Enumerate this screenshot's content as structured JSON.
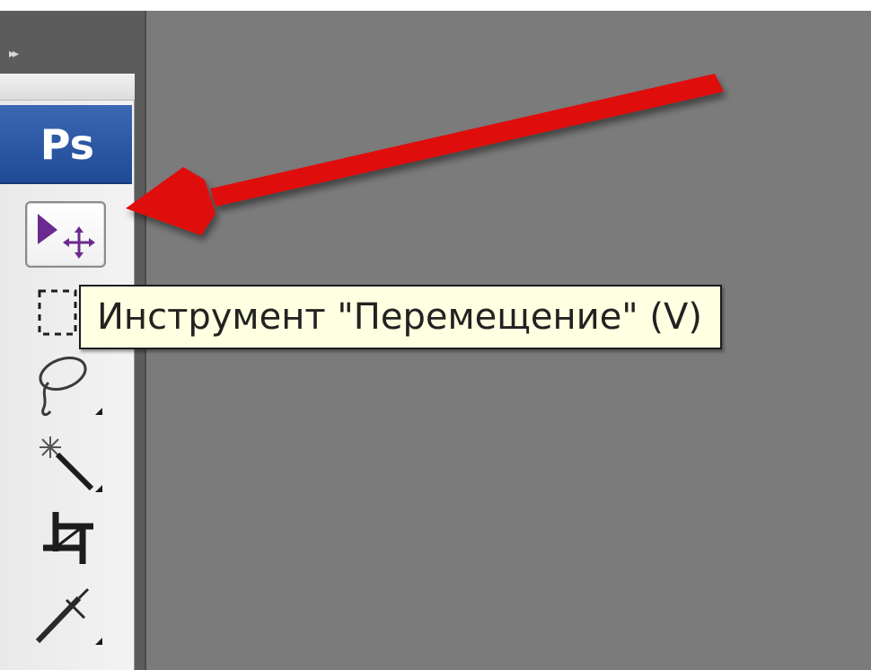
{
  "panel": {
    "collapse_icon": "double-chevron-right-icon",
    "collapse_glyph": "▸▸"
  },
  "toolbar": {
    "logo_text": "Ps",
    "tools": [
      {
        "name": "move-tool",
        "icon": "move-icon",
        "selected": true
      },
      {
        "name": "marquee-tool",
        "icon": "marquee-icon",
        "selected": false
      },
      {
        "name": "lasso-tool",
        "icon": "lasso-icon",
        "selected": false
      },
      {
        "name": "magic-wand-tool",
        "icon": "magic-wand-icon",
        "selected": false
      },
      {
        "name": "crop-tool",
        "icon": "crop-icon",
        "selected": false
      },
      {
        "name": "eyedropper-tool",
        "icon": "eyedropper-icon",
        "selected": false
      }
    ]
  },
  "tooltip": {
    "text": "Инструмент \"Перемещение\" (V)"
  },
  "colors": {
    "workspace": "#7b7b7b",
    "logo": "#2a56a4",
    "tool_accent": "#6b2a8f",
    "arrow": "#e01010",
    "tooltip_bg": "#ffffe1"
  }
}
